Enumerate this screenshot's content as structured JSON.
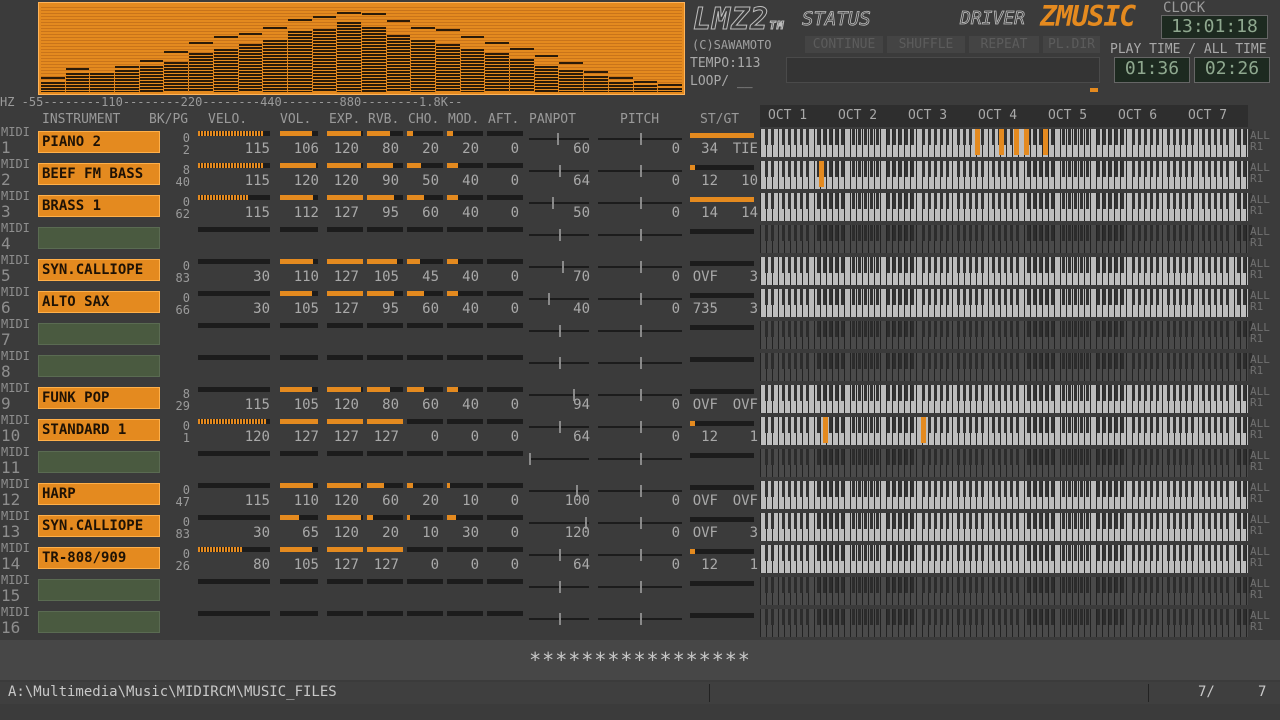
{
  "spectrum": {
    "levels": [
      0.12,
      0.22,
      0.18,
      0.25,
      0.3,
      0.35,
      0.45,
      0.5,
      0.55,
      0.6,
      0.7,
      0.72,
      0.8,
      0.75,
      0.65,
      0.6,
      0.55,
      0.5,
      0.45,
      0.38,
      0.3,
      0.25,
      0.18,
      0.12,
      0.08,
      0.05
    ],
    "peaks": [
      0.15,
      0.25,
      0.2,
      0.28,
      0.35,
      0.45,
      0.55,
      0.62,
      0.65,
      0.72,
      0.82,
      0.85,
      0.9,
      0.88,
      0.8,
      0.72,
      0.7,
      0.62,
      0.55,
      0.48,
      0.4,
      0.32,
      0.22,
      0.15,
      0.1,
      0.07
    ],
    "hz_scale": "HZ -55--------110--------220--------440--------880--------1.8K--"
  },
  "header": {
    "logo": "LMZ2",
    "logo_tm": "TM",
    "status_label": "STATUS",
    "driver_label": "DRIVER",
    "driver_name": "ZMUSIC",
    "clock_label": "CLOCK",
    "clock": "13:01:18",
    "copyright": "(C)SAWAMOTO",
    "buttons": [
      "CONTINUE",
      "SHUFFLE",
      "REPEAT",
      "PL.DIR"
    ],
    "playtime_label": "PLAY TIME / ALL TIME",
    "play_time": "01:36",
    "all_time": "02:26",
    "tempo": "TEMPO:113",
    "loop": "LOOP/ __"
  },
  "columns": {
    "instrument": "INSTRUMENT",
    "bkpg": "BK/PG",
    "velo": "VELO.",
    "vol": "VOL.",
    "exp": "EXP.",
    "rvb": "RVB.",
    "cho": "CHO.",
    "mod": "MOD.",
    "aft": "AFT.",
    "panpot": "PANPOT",
    "pitch": "PITCH",
    "stgt": "ST/GT"
  },
  "octaves": [
    "OCT 1",
    "OCT 2",
    "OCT 3",
    "OCT 4",
    "OCT 5",
    "OCT 6",
    "OCT 7"
  ],
  "channels": [
    {
      "midi": "MIDI",
      "num": "1",
      "inst": "PIANO 2",
      "bk": "0",
      "pg": "2",
      "velo": "115",
      "vol": "106",
      "exp": "120",
      "rvb": "80",
      "cho": "20",
      "mod": "20",
      "aft": "0",
      "pan": "60",
      "pitch": "0",
      "st": "34",
      "gt": "TIE",
      "active": true,
      "velo_f": 0.9,
      "vol_f": 0.83,
      "exp_f": 0.94,
      "rvb_f": 0.63,
      "cho_f": 0.16,
      "mod_f": 0.16,
      "pan_f": 0.47,
      "notes": [
        0.44,
        0.49,
        0.52,
        0.54,
        0.58
      ],
      "side": "ALL R1"
    },
    {
      "midi": "MIDI",
      "num": "2",
      "inst": "BEEF FM BASS",
      "bk": "8",
      "pg": "40",
      "velo": "115",
      "vol": "120",
      "exp": "120",
      "rvb": "90",
      "cho": "50",
      "mod": "40",
      "aft": "0",
      "pan": "64",
      "pitch": "0",
      "st": "12",
      "gt": "10",
      "active": true,
      "velo_f": 0.9,
      "vol_f": 0.94,
      "exp_f": 0.94,
      "rvb_f": 0.71,
      "cho_f": 0.39,
      "mod_f": 0.31,
      "pan_f": 0.5,
      "notes": [
        0.12
      ],
      "side": "ALL R1"
    },
    {
      "midi": "MIDI",
      "num": "3",
      "inst": "BRASS 1",
      "bk": "0",
      "pg": "62",
      "velo": "115",
      "vol": "112",
      "exp": "127",
      "rvb": "95",
      "cho": "60",
      "mod": "40",
      "aft": "0",
      "pan": "50",
      "pitch": "0",
      "st": "14",
      "gt": "14",
      "active": true,
      "velo_f": 0.7,
      "vol_f": 0.88,
      "exp_f": 1.0,
      "rvb_f": 0.75,
      "cho_f": 0.47,
      "mod_f": 0.31,
      "pan_f": 0.39,
      "notes": [],
      "side": "ALL R1"
    },
    {
      "midi": "MIDI",
      "num": "4",
      "inst": "",
      "bk": "",
      "pg": "",
      "velo": "",
      "vol": "",
      "exp": "",
      "rvb": "",
      "cho": "",
      "mod": "",
      "aft": "",
      "pan": "",
      "pitch": "",
      "st": "",
      "gt": "",
      "active": false,
      "pan_f": 0.5,
      "notes": [],
      "side": "ALL R1"
    },
    {
      "midi": "MIDI",
      "num": "5",
      "inst": "SYN.CALLIOPE",
      "bk": "0",
      "pg": "83",
      "velo": "30",
      "vol": "110",
      "exp": "127",
      "rvb": "105",
      "cho": "45",
      "mod": "40",
      "aft": "0",
      "pan": "70",
      "pitch": "0",
      "st": "OVF",
      "gt": "3",
      "active": true,
      "velo_f": 0,
      "vol_f": 0.87,
      "exp_f": 1.0,
      "rvb_f": 0.83,
      "cho_f": 0.35,
      "mod_f": 0.31,
      "pan_f": 0.55,
      "notes": [],
      "side": "ALL R1"
    },
    {
      "midi": "MIDI",
      "num": "6",
      "inst": "ALTO SAX",
      "bk": "0",
      "pg": "66",
      "velo": "30",
      "vol": "105",
      "exp": "127",
      "rvb": "95",
      "cho": "60",
      "mod": "40",
      "aft": "0",
      "pan": "40",
      "pitch": "0",
      "st": "735",
      "gt": "3",
      "active": true,
      "velo_f": 0,
      "vol_f": 0.83,
      "exp_f": 1.0,
      "rvb_f": 0.75,
      "cho_f": 0.47,
      "mod_f": 0.31,
      "pan_f": 0.31,
      "notes": [],
      "side": "ALL R1"
    },
    {
      "midi": "MIDI",
      "num": "7",
      "inst": "",
      "bk": "",
      "pg": "",
      "velo": "",
      "vol": "",
      "exp": "",
      "rvb": "",
      "cho": "",
      "mod": "",
      "aft": "",
      "pan": "",
      "pitch": "",
      "st": "",
      "gt": "",
      "active": false,
      "pan_f": 0.5,
      "notes": [],
      "side": "ALL R1"
    },
    {
      "midi": "MIDI",
      "num": "8",
      "inst": "",
      "bk": "",
      "pg": "",
      "velo": "",
      "vol": "",
      "exp": "",
      "rvb": "",
      "cho": "",
      "mod": "",
      "aft": "",
      "pan": "",
      "pitch": "",
      "st": "",
      "gt": "",
      "active": false,
      "pan_f": 0.5,
      "notes": [],
      "side": "ALL R1"
    },
    {
      "midi": "MIDI",
      "num": "9",
      "inst": "FUNK POP",
      "bk": "8",
      "pg": "29",
      "velo": "115",
      "vol": "105",
      "exp": "120",
      "rvb": "80",
      "cho": "60",
      "mod": "40",
      "aft": "0",
      "pan": "94",
      "pitch": "0",
      "st": "OVF",
      "gt": "OVF",
      "active": true,
      "velo_f": 0,
      "vol_f": 0.83,
      "exp_f": 0.94,
      "rvb_f": 0.63,
      "cho_f": 0.47,
      "mod_f": 0.31,
      "pan_f": 0.74,
      "notes": [],
      "side": "ALL R1"
    },
    {
      "midi": "MIDI",
      "num": "10",
      "inst": "STANDARD 1",
      "bk": "0",
      "pg": "1",
      "velo": "120",
      "vol": "127",
      "exp": "127",
      "rvb": "127",
      "cho": "0",
      "mod": "0",
      "aft": "0",
      "pan": "64",
      "pitch": "0",
      "st": "12",
      "gt": "1",
      "active": true,
      "velo_f": 0.94,
      "vol_f": 1.0,
      "exp_f": 1.0,
      "rvb_f": 1.0,
      "cho_f": 0,
      "mod_f": 0,
      "pan_f": 0.5,
      "notes": [
        0.13,
        0.33
      ],
      "side": "ALL R1"
    },
    {
      "midi": "MIDI",
      "num": "11",
      "inst": "",
      "bk": "",
      "pg": "",
      "velo": "",
      "vol": "",
      "exp": "",
      "rvb": "",
      "cho": "",
      "mod": "",
      "aft": "",
      "pan": "",
      "pitch": "",
      "st": "",
      "gt": "",
      "active": false,
      "pan_f": 0.0,
      "notes": [],
      "side": "ALL R1"
    },
    {
      "midi": "MIDI",
      "num": "12",
      "inst": "HARP",
      "bk": "0",
      "pg": "47",
      "velo": "115",
      "vol": "110",
      "exp": "120",
      "rvb": "60",
      "cho": "20",
      "mod": "10",
      "aft": "0",
      "pan": "100",
      "pitch": "0",
      "st": "OVF",
      "gt": "OVF",
      "active": true,
      "velo_f": 0,
      "vol_f": 0.87,
      "exp_f": 0.94,
      "rvb_f": 0.47,
      "cho_f": 0.16,
      "mod_f": 0.08,
      "pan_f": 0.79,
      "notes": [],
      "side": "ALL R1"
    },
    {
      "midi": "MIDI",
      "num": "13",
      "inst": "SYN.CALLIOPE",
      "bk": "0",
      "pg": "83",
      "velo": "30",
      "vol": "65",
      "exp": "120",
      "rvb": "20",
      "cho": "10",
      "mod": "30",
      "aft": "0",
      "pan": "120",
      "pitch": "0",
      "st": "OVF",
      "gt": "3",
      "active": true,
      "velo_f": 0,
      "vol_f": 0.51,
      "exp_f": 0.94,
      "rvb_f": 0.16,
      "cho_f": 0.08,
      "mod_f": 0.24,
      "pan_f": 0.94,
      "notes": [],
      "side": "ALL R1"
    },
    {
      "midi": "MIDI",
      "num": "14",
      "inst": "TR-808/909",
      "bk": "0",
      "pg": "26",
      "velo": "80",
      "vol": "105",
      "exp": "127",
      "rvb": "127",
      "cho": "0",
      "mod": "0",
      "aft": "0",
      "pan": "64",
      "pitch": "0",
      "st": "12",
      "gt": "1",
      "active": true,
      "velo_f": 0.63,
      "vol_f": 0.83,
      "exp_f": 1.0,
      "rvb_f": 1.0,
      "cho_f": 0,
      "mod_f": 0,
      "pan_f": 0.5,
      "notes": [],
      "side": "ALL R1"
    },
    {
      "midi": "MIDI",
      "num": "15",
      "inst": "",
      "bk": "",
      "pg": "",
      "velo": "",
      "vol": "",
      "exp": "",
      "rvb": "",
      "cho": "",
      "mod": "",
      "aft": "",
      "pan": "",
      "pitch": "",
      "st": "",
      "gt": "",
      "active": false,
      "pan_f": 0.5,
      "notes": [],
      "side": "ALL R1"
    },
    {
      "midi": "MIDI",
      "num": "16",
      "inst": "",
      "bk": "",
      "pg": "",
      "velo": "",
      "vol": "",
      "exp": "",
      "rvb": "",
      "cho": "",
      "mod": "",
      "aft": "",
      "pan": "",
      "pitch": "",
      "st": "",
      "gt": "",
      "active": false,
      "pan_f": 0.5,
      "notes": [],
      "side": "ALL R1"
    }
  ],
  "status": {
    "marquee": "*****************",
    "path": "A:\\Multimedia\\Music\\MIDIRCM\\MUSIC_FILES",
    "count": "7/",
    "total": "7"
  },
  "colors": {
    "accent": "#e48a1f",
    "bg": "#3b3b3b"
  }
}
